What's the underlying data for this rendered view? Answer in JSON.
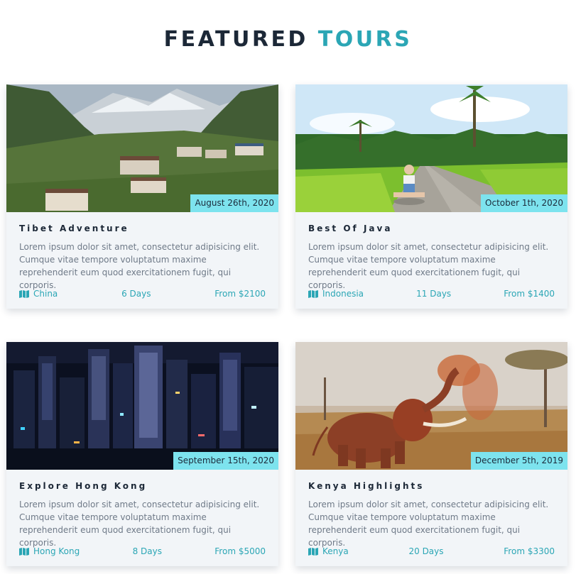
{
  "heading": {
    "part1": "FEATURED",
    "part2": "TOURS"
  },
  "colors": {
    "accent": "#2ba6b5",
    "badge": "#7de3ee",
    "card_bg": "#f2f5f8"
  },
  "tours": [
    {
      "title": "Tibet Adventure",
      "date": "August 26th, 2020",
      "description": "Lorem ipsum dolor sit amet, consectetur adipisicing elit. Cumque vitae tempore voluptatum maxime reprehenderit eum quod exercitationem fugit, qui corporis.",
      "country": "China",
      "duration": "6 Days",
      "price": "From $2100",
      "icon": "map-icon"
    },
    {
      "title": "Best Of Java",
      "date": "October 1th, 2020",
      "description": "Lorem ipsum dolor sit amet, consectetur adipisicing elit. Cumque vitae tempore voluptatum maxime reprehenderit eum quod exercitationem fugit, qui corporis.",
      "country": "Indonesia",
      "duration": "11 Days",
      "price": "From $1400",
      "icon": "map-icon"
    },
    {
      "title": "Explore Hong Kong",
      "date": "September 15th, 2020",
      "description": "Lorem ipsum dolor sit amet, consectetur adipisicing elit. Cumque vitae tempore voluptatum maxime reprehenderit eum quod exercitationem fugit, qui corporis.",
      "country": "Hong Kong",
      "duration": "8 Days",
      "price": "From $5000",
      "icon": "map-icon"
    },
    {
      "title": "Kenya Highlights",
      "date": "December 5th, 2019",
      "description": "Lorem ipsum dolor sit amet, consectetur adipisicing elit. Cumque vitae tempore voluptatum maxime reprehenderit eum quod exercitationem fugit, qui corporis.",
      "country": "Kenya",
      "duration": "20 Days",
      "price": "From $3300",
      "icon": "map-icon"
    }
  ]
}
